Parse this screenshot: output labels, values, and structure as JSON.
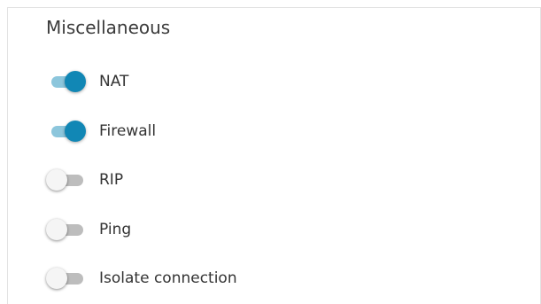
{
  "section": {
    "title": "Miscellaneous"
  },
  "toggles": [
    {
      "label": "NAT",
      "checked": true
    },
    {
      "label": "Firewall",
      "checked": true
    },
    {
      "label": "RIP",
      "checked": false
    },
    {
      "label": "Ping",
      "checked": false
    },
    {
      "label": "Isolate connection",
      "checked": false
    }
  ],
  "colors": {
    "accent": "#1187b5",
    "accent_track": "#8cc6dc",
    "off_track": "#bdbdbd",
    "off_knob": "#f5f5f5"
  }
}
